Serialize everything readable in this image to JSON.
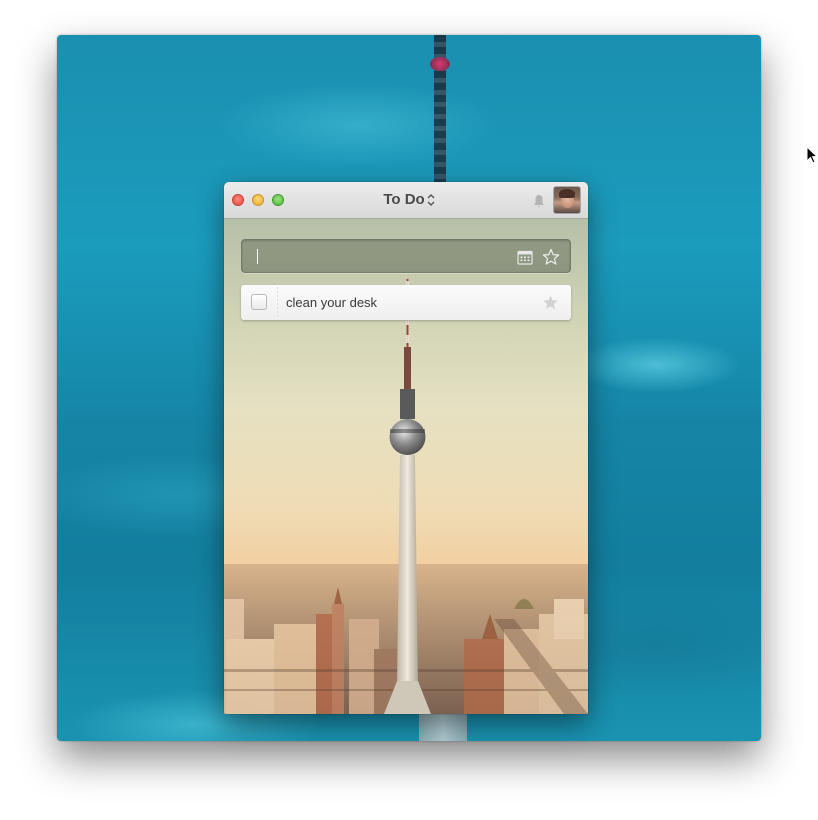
{
  "window": {
    "title": "To Do",
    "list_switcher_glyph": "chevron-up-down-icon",
    "notifications_icon": "bell-icon",
    "user_avatar": "avatar"
  },
  "input": {
    "value": "",
    "placeholder": "",
    "due_date_icon": "calendar-icon",
    "star_icon": "star-outline-icon"
  },
  "todos": [
    {
      "label": "clean your desk",
      "completed": false,
      "starred": false
    }
  ],
  "colors": {
    "close": "#e0443e",
    "minimize": "#e5a82a",
    "maximize": "#4fb43a",
    "desktop": "#1b8fb0"
  }
}
